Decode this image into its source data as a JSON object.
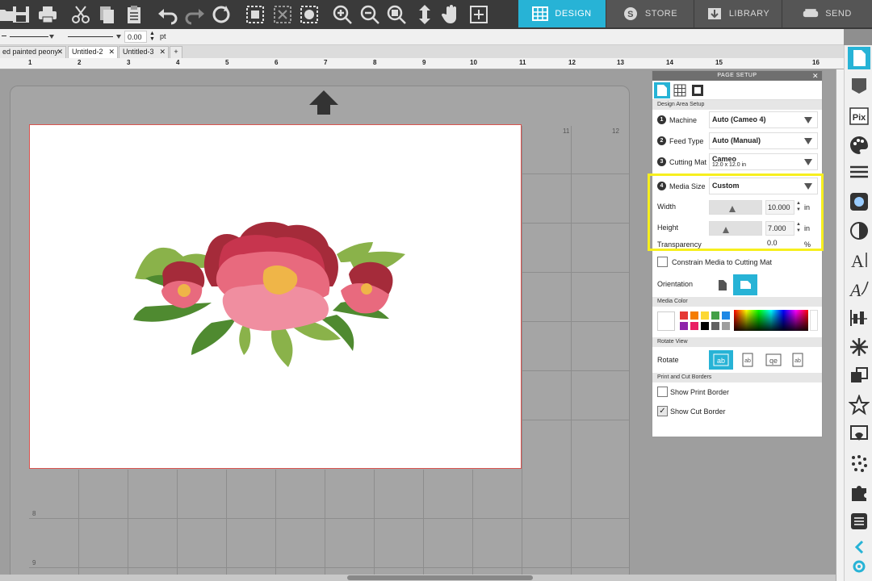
{
  "nav": {
    "design": "DESIGN",
    "store": "STORE",
    "library": "LIBRARY",
    "send": "SEND"
  },
  "linebar": {
    "stroke_value": "0.00",
    "stroke_unit": "pt"
  },
  "tabs": [
    {
      "label": "ed painted peony"
    },
    {
      "label": "Untitled-2"
    },
    {
      "label": "Untitled-3"
    }
  ],
  "ruler": {
    "ticks": [
      "1",
      "2",
      "3",
      "4",
      "5",
      "6",
      "7",
      "8",
      "9",
      "10",
      "11",
      "12",
      "13",
      "14",
      "15",
      "16"
    ]
  },
  "grid_numbers": {
    "col11": "11",
    "col12": "12",
    "row8": "8",
    "row9": "9"
  },
  "panel": {
    "title": "PAGE SETUP",
    "design_area_setup": "Design Area Setup",
    "machine_label": "Machine",
    "machine_value": "Auto (Cameo 4)",
    "feed_type_label": "Feed Type",
    "feed_type_value": "Auto (Manual)",
    "cutting_mat_label": "Cutting Mat",
    "cutting_mat_value": "Cameo",
    "cutting_mat_size": "12.0 x 12.0 in",
    "media_size_label": "Media Size",
    "media_size_value": "Custom",
    "width_label": "Width",
    "width_value": "10.000",
    "height_label": "Height",
    "height_value": "7.000",
    "unit": "in",
    "transparency_label": "Transparency",
    "transparency_value": "0.0",
    "transparency_unit": "%",
    "constrain_label": "Constrain Media to Cutting Mat",
    "orientation_label": "Orientation",
    "media_color_head": "Media Color",
    "rotate_view_head": "Rotate View",
    "rotate_label": "Rotate",
    "print_cut_head": "Print and Cut Borders",
    "show_print_border": "Show Print Border",
    "show_cut_border": "Show Cut Border",
    "badges": [
      "1",
      "2",
      "3",
      "4"
    ]
  },
  "colors": {
    "accent": "#27b3d6",
    "highlight": "#f7ef1e",
    "swatches_row1": [
      "#ffffff",
      "#e53935",
      "#f57c00",
      "#fdd835",
      "#43a047",
      "#1e88e5"
    ],
    "swatches_row2": [
      "#8e24aa",
      "#e91e63",
      "#000000",
      "#616161",
      "#9e9e9e"
    ]
  }
}
